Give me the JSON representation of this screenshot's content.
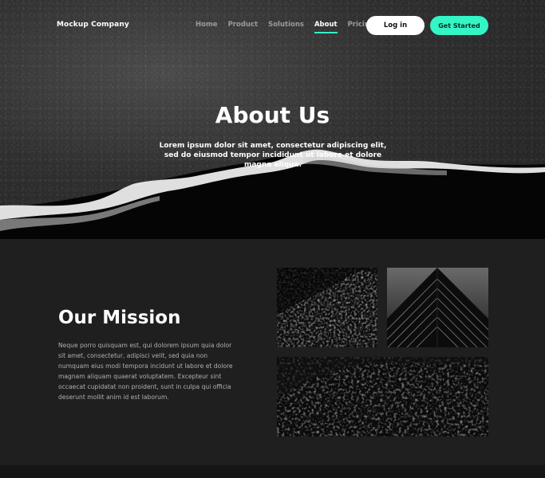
{
  "brand": {
    "name": "Mockup Company"
  },
  "nav": {
    "items": [
      {
        "label": "Home"
      },
      {
        "label": "Product"
      },
      {
        "label": "Solutions"
      },
      {
        "label": "About"
      },
      {
        "label": "Pricing"
      }
    ],
    "active": "About"
  },
  "header": {
    "login_label": "Log in",
    "cta_label": "Get Started"
  },
  "hero": {
    "title": "About Us",
    "text": "Lorem ipsum dolor sit amet, consectetur adipiscing elit, sed do eiusmod tempor incididunt ut labore et dolore magna aliqua."
  },
  "mission": {
    "title": "Our Mission",
    "text": "Neque porro quisquam est, qui dolorem ipsum quia dolor sit amet, consectetur, adipisci velit, sed quia non numquam eius modi tempora incidunt ut labore et dolore magnam aliquam quaerat voluptatem. Excepteur sint occaecat cupidatat non proident, sunt in culpa qui officia deserunt mollit anim id est laborum."
  },
  "colors": {
    "accent": "#34f5c5",
    "background": "#1f1f1f",
    "text_muted": "#b0b0b0"
  }
}
